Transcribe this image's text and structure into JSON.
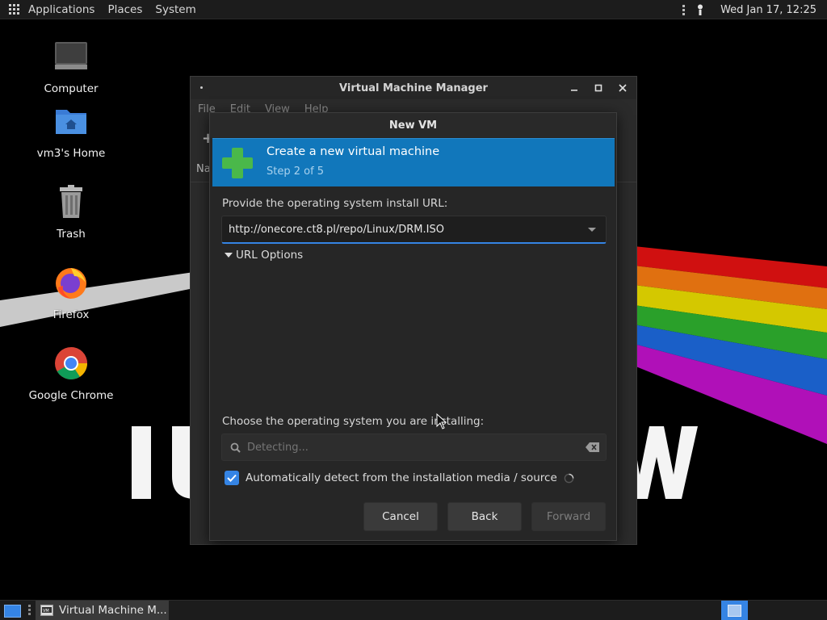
{
  "top_panel": {
    "applications_label": "Applications",
    "places_label": "Places",
    "system_label": "System",
    "clock": "Wed Jan 17, 12:25"
  },
  "desktop": {
    "icons": [
      {
        "label": "Computer",
        "icon": "computer-icon"
      },
      {
        "label": "vm3's Home",
        "icon": "home-folder-icon"
      },
      {
        "label": "Trash",
        "icon": "trash-icon"
      },
      {
        "label": "Firefox",
        "icon": "firefox-icon"
      },
      {
        "label": "Google Chrome",
        "icon": "chrome-icon"
      }
    ]
  },
  "vmm_window": {
    "title": "Virtual Machine Manager",
    "menu": [
      "File",
      "Edit",
      "View",
      "Help"
    ],
    "name_column_fragment": "Na",
    "toolbar_fragment": "+"
  },
  "dialog": {
    "title": "New VM",
    "banner_title": "Create a new virtual machine",
    "banner_step": "Step 2 of 5",
    "url_label": "Provide the operating system install URL:",
    "url_value": "http://onecore.ct8.pl/repo/Linux/DRM.ISO",
    "url_options_label": "URL Options",
    "os_label": "Choose the operating system you are installing:",
    "os_search_placeholder": "Detecting...",
    "auto_detect_label": "Automatically detect from the installation media / source",
    "auto_detect_checked": true,
    "cancel_label": "Cancel",
    "back_label": "Back",
    "forward_label": "Forward"
  },
  "taskbar": {
    "task_label": "Virtual Machine M..."
  },
  "colors": {
    "accent": "#3584e4",
    "banner": "#1177bb",
    "plus_green": "#4ab84a"
  }
}
